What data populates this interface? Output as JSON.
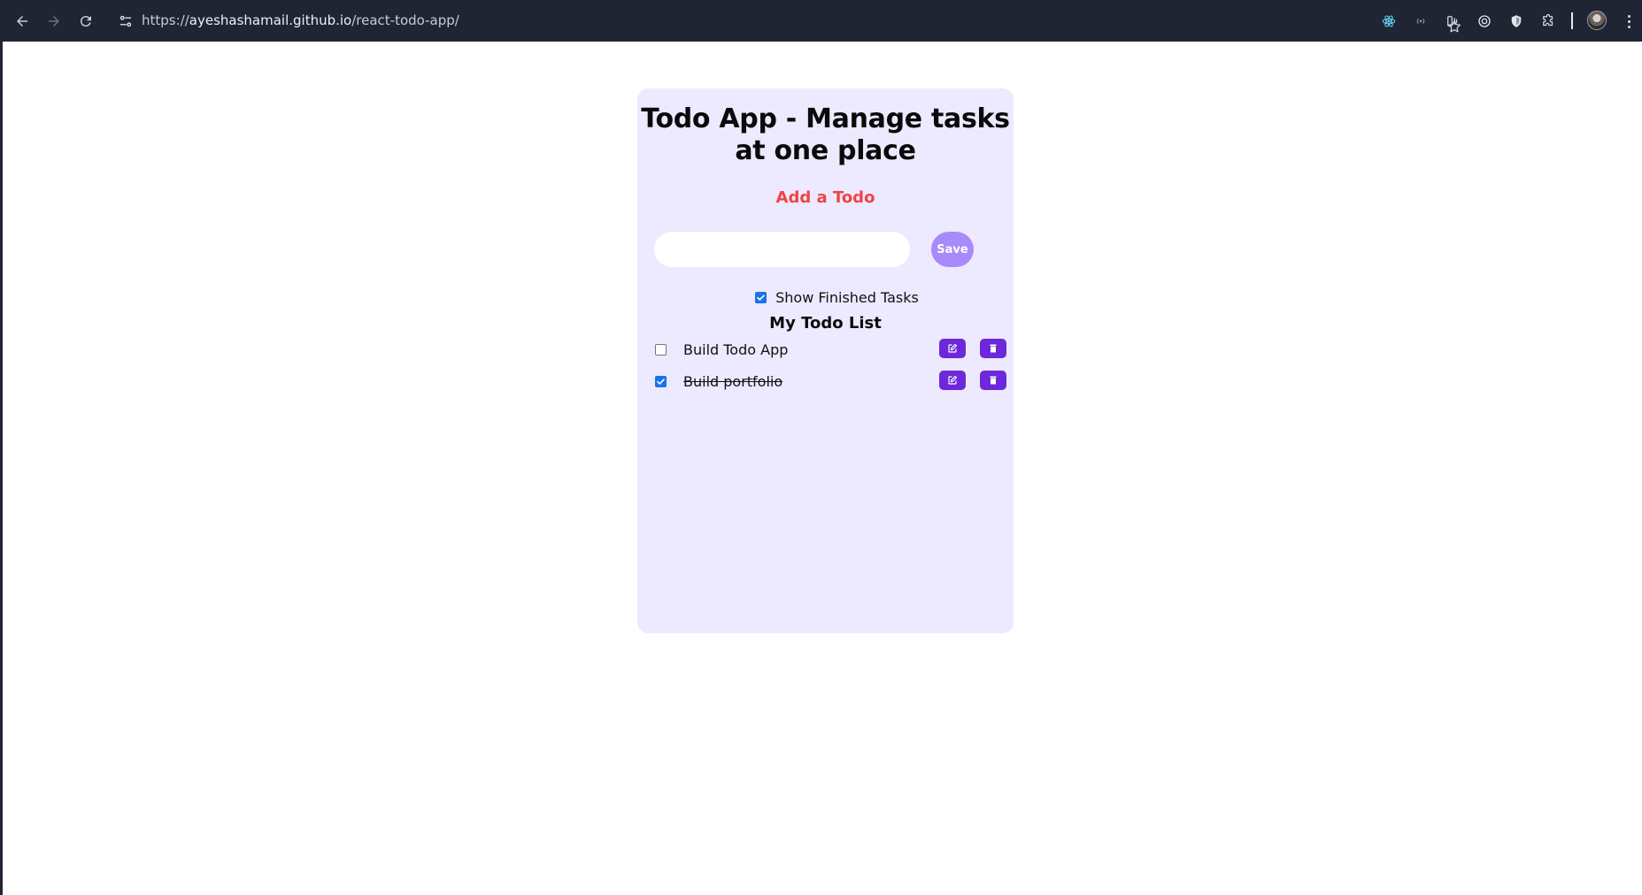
{
  "browser": {
    "url_scheme": "https://",
    "url_host": "ayeshashamail.github.io",
    "url_path": "/react-todo-app/",
    "nav_icons": [
      "back-arrow-icon",
      "forward-arrow-icon",
      "reload-icon"
    ],
    "extension_icons": [
      "react-devtools-icon",
      "extension-icon",
      "extension-icon",
      "target-icon",
      "shield-icon",
      "puzzle-icon"
    ]
  },
  "app": {
    "title": "Todo App - Manage tasks at one place",
    "add_heading": "Add a Todo",
    "input_value": "",
    "save_label": "Save",
    "show_finished_label": "Show Finished Tasks",
    "show_finished_checked": true,
    "list_heading": "My Todo List",
    "todos": [
      {
        "text": "Build Todo App",
        "completed": false
      },
      {
        "text": "Build portfolio",
        "completed": true
      }
    ]
  },
  "colors": {
    "card_bg": "#ede9fe",
    "accent": "#6d28d9",
    "save_button": "#a78bfa",
    "add_heading": "#ef4444",
    "checkbox_checked": "#1a73e8"
  }
}
